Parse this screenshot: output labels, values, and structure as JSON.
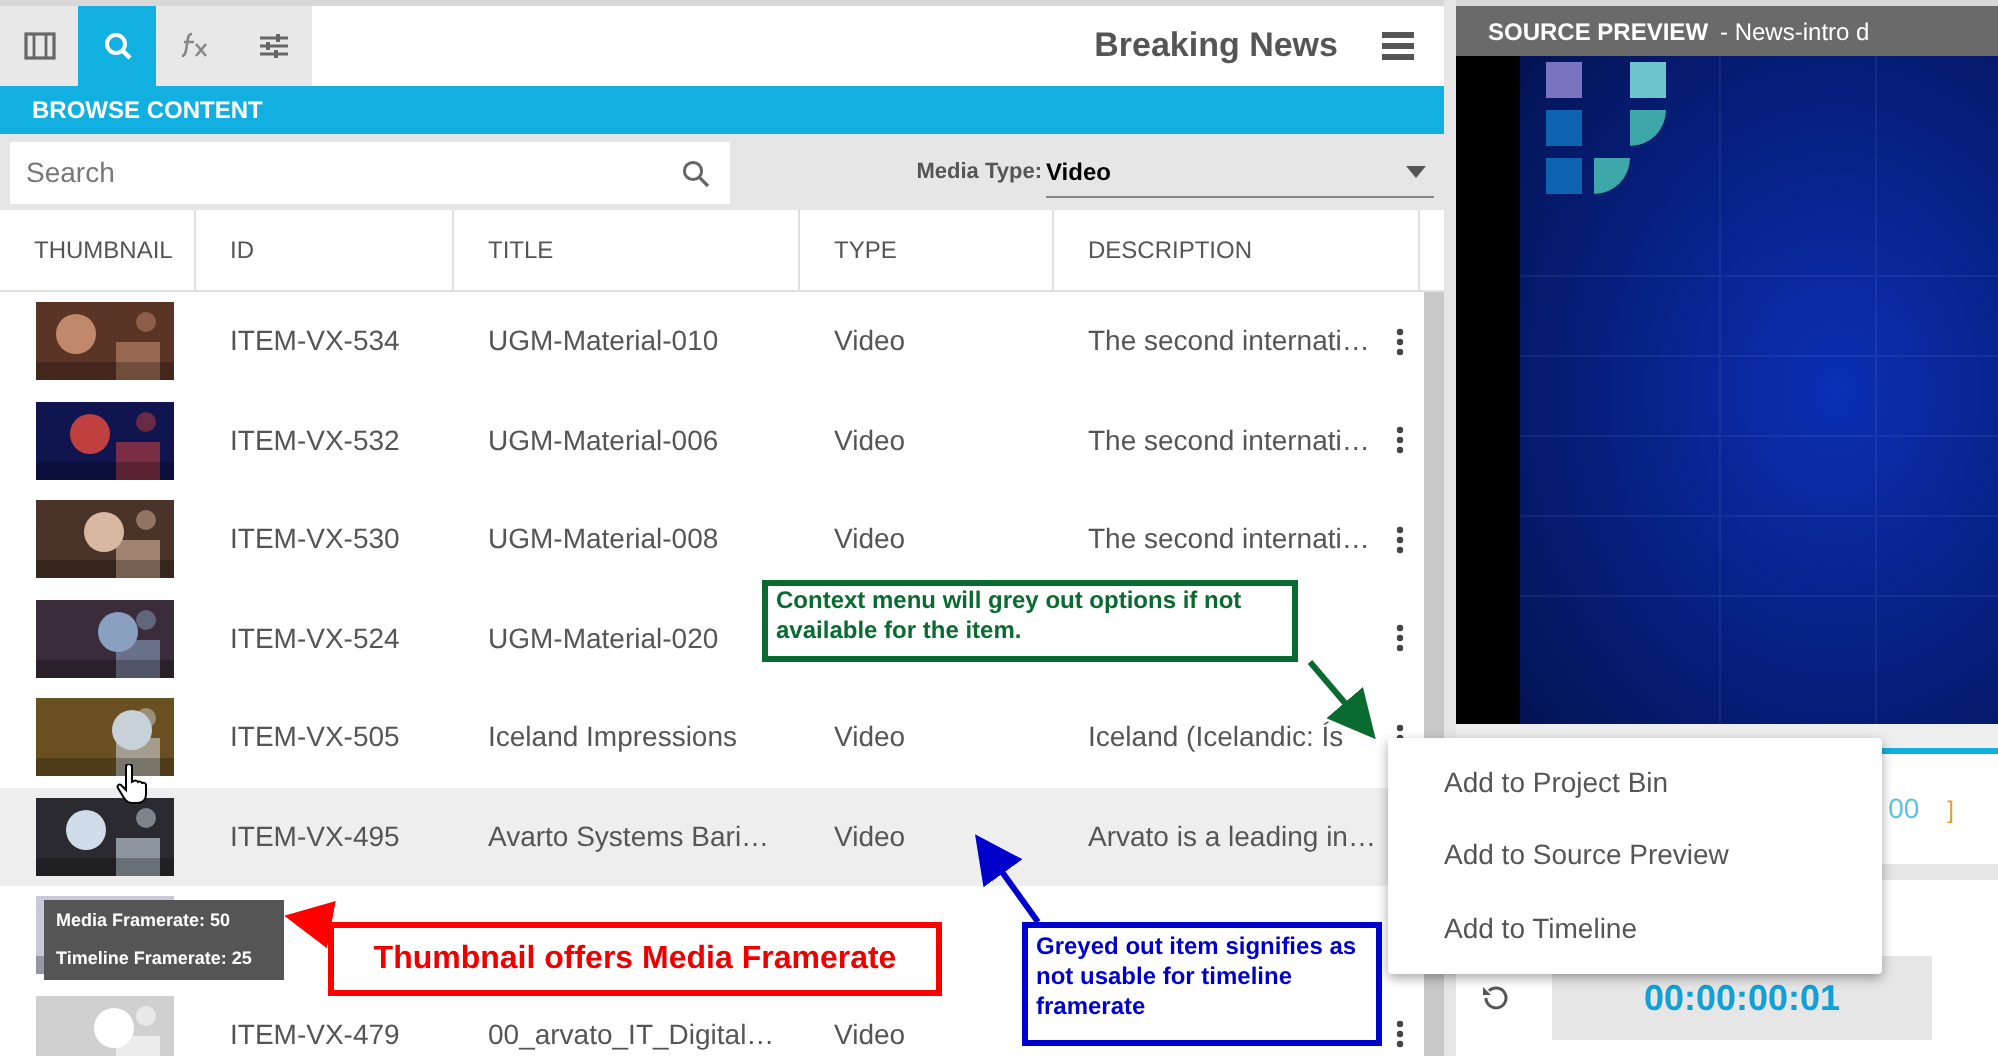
{
  "toolbar": {
    "tabs": [
      {
        "selected": false
      },
      {
        "selected": true
      },
      {
        "selected": false
      },
      {
        "selected": false
      }
    ],
    "title": "Breaking News"
  },
  "browse": {
    "header": "BROWSE CONTENT",
    "search": {
      "placeholder": "Search"
    },
    "media_type": {
      "label": "Media Type:",
      "value": "Video"
    }
  },
  "table": {
    "columns": [
      "THUMBNAIL",
      "ID",
      "TITLE",
      "TYPE",
      "DESCRIPTION"
    ],
    "rows": [
      {
        "id": "ITEM-VX-534",
        "title": "UGM-Material-010",
        "type": "Video",
        "description": "The second internati…",
        "selected": false
      },
      {
        "id": "ITEM-VX-532",
        "title": "UGM-Material-006",
        "type": "Video",
        "description": "The second internati…",
        "selected": false
      },
      {
        "id": "ITEM-VX-530",
        "title": "UGM-Material-008",
        "type": "Video",
        "description": "The second internati…",
        "selected": false
      },
      {
        "id": "ITEM-VX-524",
        "title": "UGM-Material-020",
        "selected": false
      },
      {
        "id": "ITEM-VX-505",
        "title": "Iceland Impressions",
        "type": "Video",
        "description": "Iceland (Icelandic: Ís",
        "selected": false
      },
      {
        "id": "ITEM-VX-495",
        "title": "Avarto Systems Bari…",
        "type": "Video",
        "description": "Arvato is a leading in…",
        "selected": true
      },
      {
        "selected": false
      },
      {
        "id": "ITEM-VX-479",
        "title": "00_arvato_IT_Digital…",
        "type": "Video",
        "selected": false
      }
    ]
  },
  "thumbnail_tooltip": [
    "Media Framerate: 50",
    "Timeline Framerate: 25"
  ],
  "context_menu": [
    "Add to Project Bin",
    "Add to Source Preview",
    "Add to Timeline"
  ],
  "source_preview": {
    "title": "SOURCE PREVIEW",
    "clip": "- News-intro d",
    "time_fragment": "00",
    "bracket": "]",
    "timecode": "00:00:00:01"
  },
  "callouts": [
    {
      "kind": "green",
      "text": "Context menu will grey out options if not available for the item."
    },
    {
      "kind": "red",
      "text": "Thumbnail offers Media Framerate"
    },
    {
      "kind": "blue",
      "text": "Greyed out item signifies as not usable for timeline framerate"
    }
  ]
}
